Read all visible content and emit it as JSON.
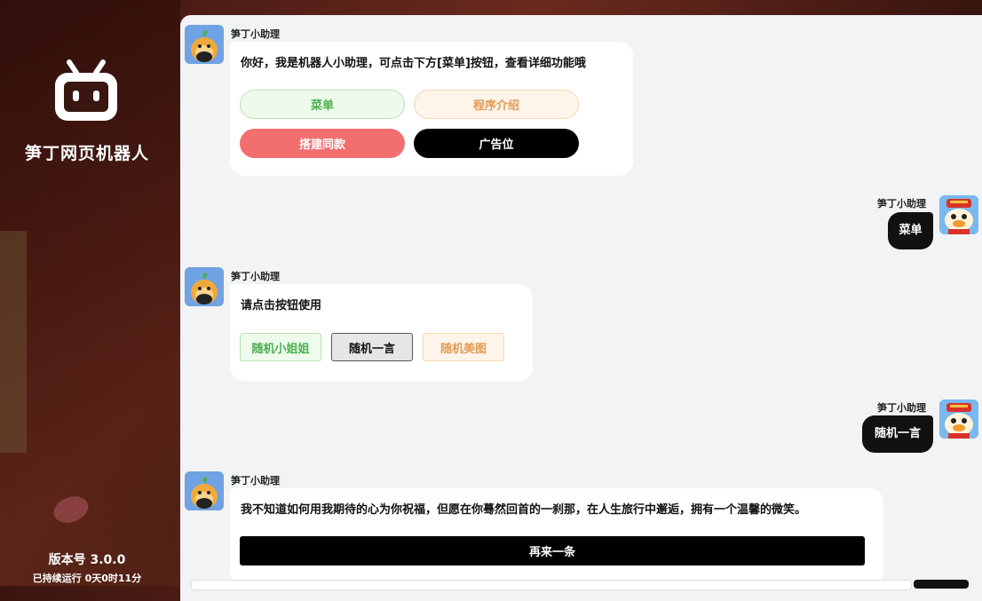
{
  "sidebar": {
    "logo_icon": "robot-tv-icon",
    "title": "笋丁网页机器人",
    "version": "版本号 3.0.0",
    "uptime": "已持续运行 0天0时11分"
  },
  "messages": [
    {
      "from": "bot",
      "sender": "笋丁小助理",
      "text": "你好，我是机器人小助理，可点击下方[菜单]按钮，查看详细功能哦",
      "buttons": [
        "菜单",
        "程序介绍",
        "搭建同款",
        "广告位"
      ]
    },
    {
      "from": "user",
      "sender": "笋丁小助理",
      "text": "菜单"
    },
    {
      "from": "bot",
      "sender": "笋丁小助理",
      "text": "请点击按钮使用",
      "buttons": [
        "随机小姐姐",
        "随机一言",
        "随机美图"
      ]
    },
    {
      "from": "user",
      "sender": "笋丁小助理",
      "text": "随机一言"
    },
    {
      "from": "bot",
      "sender": "笋丁小助理",
      "text": "我不知道如何用我期待的心为你祝福，但愿在你蓦然回首的一刹那，在人生旅行中邂逅，拥有一个温馨的微笑。",
      "buttons": [
        "再来一条"
      ]
    }
  ],
  "colors": {
    "accent_green": "#4caf50",
    "accent_orange": "#e59a52",
    "accent_red": "#f36e6e",
    "black": "#000000"
  }
}
